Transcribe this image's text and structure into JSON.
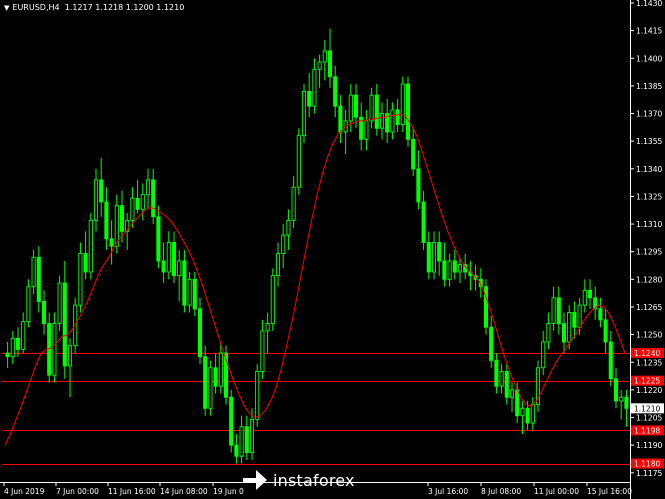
{
  "window": {
    "symbol_label": "EURUSD,H4",
    "ohlc_label": "1.1217 1.1218 1.1200 1.1210"
  },
  "colors": {
    "background": "#000000",
    "candle": "#00ff00",
    "moving_average": "#ff0000",
    "level_line": "#ff0000",
    "level_label_bg": "#ff0000",
    "current_price_label_bg": "#ffffff",
    "axis": "#ffffff"
  },
  "watermark": {
    "brand": "instaforex",
    "icon": "instaforex-logo-icon"
  },
  "chart_data": {
    "type": "candlestick",
    "title": "EURUSD,H4",
    "ylim": [
      1.117,
      1.143
    ],
    "y_ticks": [
      "1.1430",
      "1.1415",
      "1.1400",
      "1.1385",
      "1.1370",
      "1.1355",
      "1.1340",
      "1.1325",
      "1.1310",
      "1.1295",
      "1.1280",
      "1.1265",
      "1.1250",
      "1.1235",
      "1.1220",
      "1.1205",
      "1.1190",
      "1.1175"
    ],
    "x_ticks": [
      "4 Jun 2019",
      "7 Jun 00:00",
      "11 Jun 16:00",
      "14 Jun 08:00",
      "19 Jun 0",
      "3 Jul 16:00",
      "8 Jul 08:00",
      "11 Jul 00:00",
      "15 Jul 16:00"
    ],
    "current_price": "1.1210",
    "level_lines": [
      {
        "label": "1.1240",
        "value": 1.124
      },
      {
        "label": "1.1225",
        "value": 1.1225
      },
      {
        "label": "1.1198",
        "value": 1.1198
      },
      {
        "label": "1.1180",
        "value": 1.118
      }
    ],
    "candles": [
      [
        1.124,
        1.1246,
        1.1232,
        1.1238
      ],
      [
        1.1238,
        1.1252,
        1.1234,
        1.1248
      ],
      [
        1.1248,
        1.1254,
        1.1238,
        1.1242
      ],
      [
        1.1242,
        1.1262,
        1.124,
        1.1257
      ],
      [
        1.1257,
        1.128,
        1.1254,
        1.1276
      ],
      [
        1.1276,
        1.1296,
        1.1272,
        1.1292
      ],
      [
        1.1292,
        1.1298,
        1.1262,
        1.1268
      ],
      [
        1.1268,
        1.1274,
        1.125,
        1.1256
      ],
      [
        1.1256,
        1.1262,
        1.1224,
        1.1228
      ],
      [
        1.1228,
        1.1262,
        1.1224,
        1.1256
      ],
      [
        1.1256,
        1.1282,
        1.1252,
        1.1278
      ],
      [
        1.1278,
        1.129,
        1.1226,
        1.1233
      ],
      [
        1.1233,
        1.1248,
        1.1216,
        1.1244
      ],
      [
        1.1244,
        1.127,
        1.124,
        1.1266
      ],
      [
        1.1266,
        1.13,
        1.1262,
        1.1294
      ],
      [
        1.1294,
        1.1306,
        1.128,
        1.1284
      ],
      [
        1.1284,
        1.1316,
        1.128,
        1.1312
      ],
      [
        1.1312,
        1.134,
        1.1306,
        1.1334
      ],
      [
        1.1334,
        1.1346,
        1.1314,
        1.1322
      ],
      [
        1.1322,
        1.133,
        1.1296,
        1.1302
      ],
      [
        1.1302,
        1.1312,
        1.1288,
        1.1298
      ],
      [
        1.1298,
        1.1326,
        1.1294,
        1.132
      ],
      [
        1.132,
        1.1328,
        1.13,
        1.1306
      ],
      [
        1.1306,
        1.1316,
        1.1296,
        1.1312
      ],
      [
        1.1312,
        1.133,
        1.1308,
        1.1324
      ],
      [
        1.1324,
        1.1334,
        1.1316,
        1.1318
      ],
      [
        1.1318,
        1.1332,
        1.1312,
        1.1326
      ],
      [
        1.1326,
        1.134,
        1.1318,
        1.1334
      ],
      [
        1.1334,
        1.134,
        1.131,
        1.1314
      ],
      [
        1.1314,
        1.132,
        1.1286,
        1.129
      ],
      [
        1.129,
        1.13,
        1.1278,
        1.1284
      ],
      [
        1.1284,
        1.1306,
        1.128,
        1.13
      ],
      [
        1.13,
        1.1306,
        1.1278,
        1.1282
      ],
      [
        1.1282,
        1.1296,
        1.1268,
        1.129
      ],
      [
        1.129,
        1.1296,
        1.1262,
        1.1266
      ],
      [
        1.1266,
        1.1284,
        1.1262,
        1.128
      ],
      [
        1.128,
        1.1284,
        1.126,
        1.1264
      ],
      [
        1.1264,
        1.127,
        1.1234,
        1.1238
      ],
      [
        1.1238,
        1.1244,
        1.1206,
        1.121
      ],
      [
        1.121,
        1.1236,
        1.1206,
        1.1232
      ],
      [
        1.1232,
        1.124,
        1.1218,
        1.1222
      ],
      [
        1.1222,
        1.1246,
        1.1218,
        1.124
      ],
      [
        1.124,
        1.1244,
        1.1212,
        1.1216
      ],
      [
        1.1216,
        1.122,
        1.1186,
        1.119
      ],
      [
        1.119,
        1.1196,
        1.118,
        1.1184
      ],
      [
        1.1184,
        1.1206,
        1.118,
        1.12
      ],
      [
        1.12,
        1.1206,
        1.1182,
        1.1186
      ],
      [
        1.1186,
        1.121,
        1.1182,
        1.1204
      ],
      [
        1.1204,
        1.1234,
        1.12,
        1.123
      ],
      [
        1.123,
        1.1258,
        1.1226,
        1.1252
      ],
      [
        1.1252,
        1.1262,
        1.124,
        1.1256
      ],
      [
        1.1256,
        1.1286,
        1.1252,
        1.1282
      ],
      [
        1.1282,
        1.13,
        1.1276,
        1.1294
      ],
      [
        1.1294,
        1.131,
        1.1286,
        1.1304
      ],
      [
        1.1304,
        1.1318,
        1.1296,
        1.1312
      ],
      [
        1.1312,
        1.1336,
        1.1308,
        1.133
      ],
      [
        1.133,
        1.1362,
        1.1326,
        1.1358
      ],
      [
        1.1358,
        1.1386,
        1.1354,
        1.1382
      ],
      [
        1.1382,
        1.1392,
        1.1368,
        1.1374
      ],
      [
        1.1374,
        1.14,
        1.137,
        1.1394
      ],
      [
        1.1394,
        1.1402,
        1.1384,
        1.1398
      ],
      [
        1.1398,
        1.141,
        1.1388,
        1.1404
      ],
      [
        1.1404,
        1.1416,
        1.1384,
        1.139
      ],
      [
        1.139,
        1.1396,
        1.1368,
        1.1374
      ],
      [
        1.1374,
        1.138,
        1.1354,
        1.136
      ],
      [
        1.136,
        1.1372,
        1.1348,
        1.1366
      ],
      [
        1.1366,
        1.1386,
        1.136,
        1.138
      ],
      [
        1.138,
        1.1386,
        1.1362,
        1.1368
      ],
      [
        1.1368,
        1.1376,
        1.135,
        1.1356
      ],
      [
        1.1356,
        1.1372,
        1.135,
        1.1366
      ],
      [
        1.1366,
        1.1384,
        1.1362,
        1.138
      ],
      [
        1.138,
        1.1386,
        1.1358,
        1.1362
      ],
      [
        1.1362,
        1.1376,
        1.1356,
        1.137
      ],
      [
        1.137,
        1.1378,
        1.1354,
        1.136
      ],
      [
        1.136,
        1.1376,
        1.1356,
        1.1372
      ],
      [
        1.1372,
        1.1378,
        1.136,
        1.1364
      ],
      [
        1.1364,
        1.139,
        1.136,
        1.1386
      ],
      [
        1.1386,
        1.139,
        1.1352,
        1.1356
      ],
      [
        1.1356,
        1.1362,
        1.1336,
        1.134
      ],
      [
        1.134,
        1.135,
        1.1318,
        1.1322
      ],
      [
        1.1322,
        1.1328,
        1.1296,
        1.13
      ],
      [
        1.13,
        1.1306,
        1.128,
        1.1284
      ],
      [
        1.1284,
        1.1306,
        1.128,
        1.13
      ],
      [
        1.13,
        1.1306,
        1.1282,
        1.129
      ],
      [
        1.129,
        1.13,
        1.1276,
        1.128
      ],
      [
        1.128,
        1.1294,
        1.1276,
        1.129
      ],
      [
        1.129,
        1.1296,
        1.128,
        1.1284
      ],
      [
        1.1284,
        1.1292,
        1.1278,
        1.1288
      ],
      [
        1.1288,
        1.1294,
        1.128,
        1.1284
      ],
      [
        1.1284,
        1.129,
        1.1274,
        1.1282
      ],
      [
        1.1282,
        1.1288,
        1.1274,
        1.128
      ],
      [
        1.128,
        1.1286,
        1.127,
        1.1276
      ],
      [
        1.1276,
        1.128,
        1.125,
        1.1254
      ],
      [
        1.1254,
        1.126,
        1.1232,
        1.1236
      ],
      [
        1.1236,
        1.124,
        1.1218,
        1.1222
      ],
      [
        1.1222,
        1.1234,
        1.1218,
        1.123
      ],
      [
        1.123,
        1.1234,
        1.1212,
        1.1216
      ],
      [
        1.1216,
        1.1224,
        1.1208,
        1.122
      ],
      [
        1.122,
        1.1224,
        1.1202,
        1.1206
      ],
      [
        1.1206,
        1.1214,
        1.1196,
        1.121
      ],
      [
        1.121,
        1.1214,
        1.1198,
        1.1202
      ],
      [
        1.1202,
        1.1216,
        1.1198,
        1.1212
      ],
      [
        1.1212,
        1.1236,
        1.1208,
        1.1232
      ],
      [
        1.1232,
        1.1252,
        1.1228,
        1.1246
      ],
      [
        1.1246,
        1.1262,
        1.1242,
        1.1256
      ],
      [
        1.1256,
        1.1276,
        1.1252,
        1.127
      ],
      [
        1.127,
        1.1276,
        1.125,
        1.1256
      ],
      [
        1.1256,
        1.1262,
        1.124,
        1.1246
      ],
      [
        1.1246,
        1.1266,
        1.1242,
        1.1262
      ],
      [
        1.1262,
        1.1268,
        1.1248,
        1.1254
      ],
      [
        1.1254,
        1.127,
        1.125,
        1.1266
      ],
      [
        1.1266,
        1.128,
        1.1262,
        1.1274
      ],
      [
        1.1274,
        1.128,
        1.1264,
        1.127
      ],
      [
        1.127,
        1.1276,
        1.1258,
        1.1264
      ],
      [
        1.1264,
        1.127,
        1.1254,
        1.1258
      ],
      [
        1.1258,
        1.1264,
        1.124,
        1.1246
      ],
      [
        1.1246,
        1.1252,
        1.1222,
        1.1226
      ],
      [
        1.1226,
        1.1232,
        1.121,
        1.1214
      ],
      [
        1.1214,
        1.122,
        1.1204,
        1.1216
      ],
      [
        1.1216,
        1.122,
        1.12,
        1.121
      ]
    ],
    "moving_average": [
      1.119,
      1.1196,
      1.1203,
      1.121,
      1.1218,
      1.1226,
      1.1234,
      1.124,
      1.1242,
      1.1243,
      1.1246,
      1.1249,
      1.125,
      1.1253,
      1.1258,
      1.1263,
      1.1269,
      1.1276,
      1.1283,
      1.1288,
      1.1292,
      1.1298,
      1.1302,
      1.1305,
      1.1309,
      1.1312,
      1.1315,
      1.1318,
      1.1319,
      1.1318,
      1.1316,
      1.1314,
      1.1311,
      1.1307,
      1.1302,
      1.1297,
      1.1291,
      1.1284,
      1.1276,
      1.1267,
      1.1258,
      1.1249,
      1.124,
      1.1232,
      1.1224,
      1.1217,
      1.1211,
      1.1207,
      1.1205,
      1.1206,
      1.1209,
      1.1214,
      1.1221,
      1.1231,
      1.1243,
      1.1256,
      1.127,
      1.1285,
      1.13,
      1.1314,
      1.1327,
      1.1338,
      1.1347,
      1.1354,
      1.1359,
      1.1362,
      1.1364,
      1.1365,
      1.1366,
      1.1366,
      1.1367,
      1.1367,
      1.1368,
      1.1368,
      1.1369,
      1.1369,
      1.137,
      1.1368,
      1.1364,
      1.1358,
      1.135,
      1.1341,
      1.1332,
      1.1323,
      1.1314,
      1.1306,
      1.1299,
      1.1293,
      1.1288,
      1.1285,
      1.1282,
      1.1279,
      1.1273,
      1.1265,
      1.1256,
      1.1246,
      1.1237,
      1.1229,
      1.1222,
      1.1216,
      1.1212,
      1.1211,
      1.1214,
      1.1219,
      1.1225,
      1.1231,
      1.1236,
      1.124,
      1.1244,
      1.1248,
      1.1252,
      1.1257,
      1.1261,
      1.1264,
      1.1266,
      1.1265,
      1.1261,
      1.1255,
      1.1248,
      1.124
    ]
  }
}
